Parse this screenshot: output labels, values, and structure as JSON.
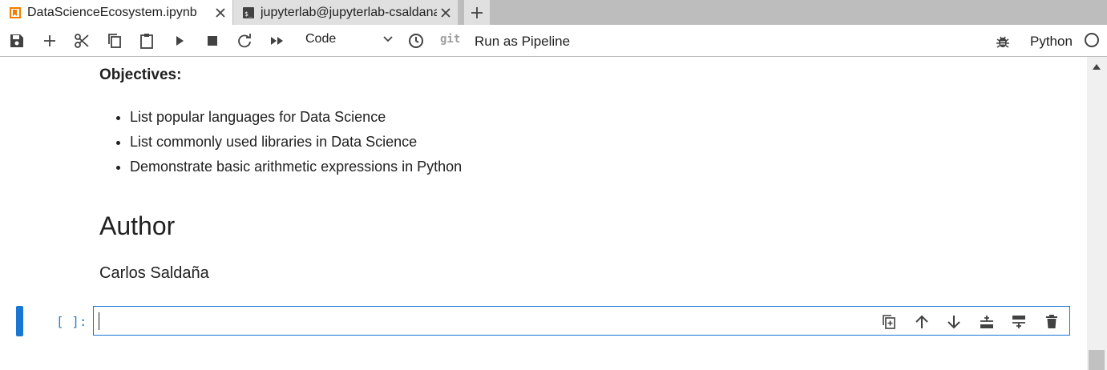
{
  "tabs": [
    {
      "label": "DataScienceEcosystem.ipynb",
      "icon": "notebook-icon",
      "active": true
    },
    {
      "label": "jupyterlab@jupyterlab-csaldana",
      "icon": "terminal-icon",
      "active": false
    }
  ],
  "toolbar": {
    "cell_type": "Code",
    "git_label": "git",
    "pipeline_label": "Run as Pipeline",
    "kernel_name": "Python"
  },
  "notebook": {
    "objectives_heading": "Objectives:",
    "objectives": [
      "List popular languages for Data Science",
      "List commonly used libraries in Data Science",
      "Demonstrate basic arithmetic expressions in Python"
    ],
    "author_heading": "Author",
    "author_name": "Carlos Saldaña",
    "code_prompt": "[ ]:",
    "code_value": ""
  },
  "colors": {
    "accent": "#1976d2",
    "notebook_icon": "#f57c00",
    "prompt": "#307fc1"
  }
}
